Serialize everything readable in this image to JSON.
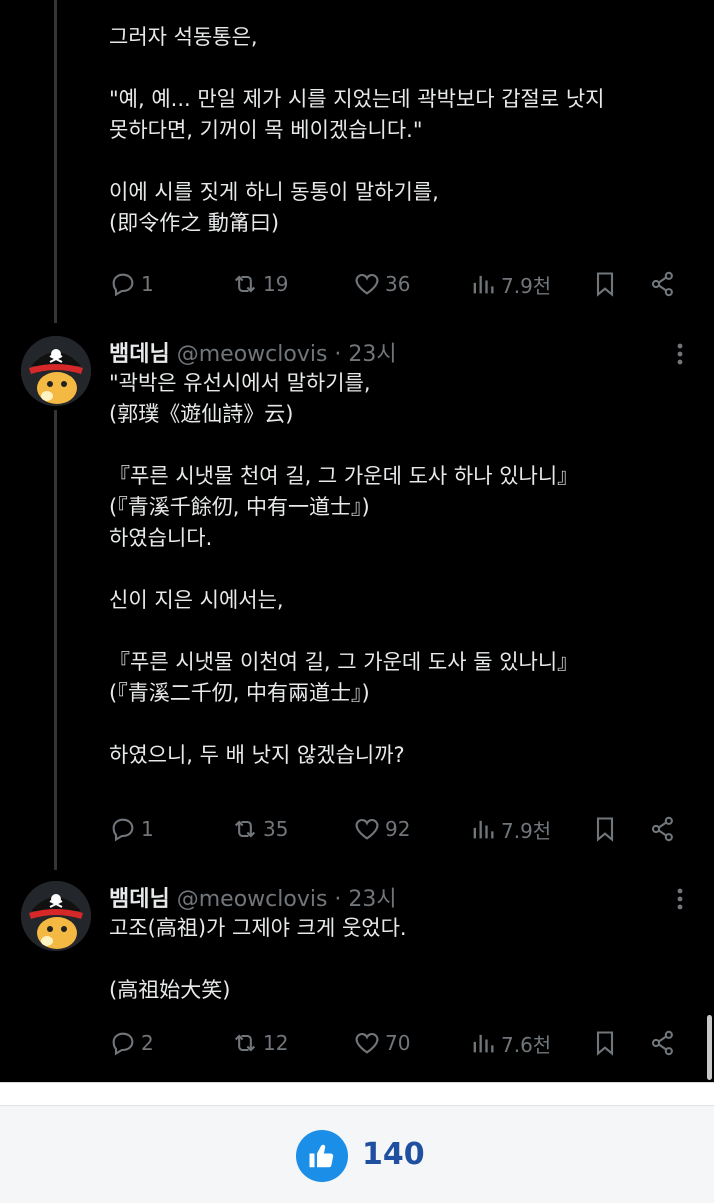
{
  "tweet1": {
    "lines": [
      "그러자 석동통은,",
      "",
      "\"예, 예... 만일 제가 시를 지었는데 곽박보다 갑절로 낫지",
      "못하다면, 기꺼이 목 베이겠습니다.\"",
      "",
      "이에 시를 짓게 하니 동통이 말하기를,",
      "(即令作之 動筩曰)"
    ],
    "replies": "1",
    "retweets": "19",
    "likes": "36",
    "views": "7.9천"
  },
  "tweet2": {
    "name": "뱀데님",
    "handle": "@meowclovis",
    "time": "· 23시",
    "lines": [
      "\"곽박은 유선시에서 말하기를,",
      "(郭璞《遊仙詩》云)",
      "",
      "『푸른 시냇물 천여 길, 그 가운데 도사 하나 있나니』",
      "(『青溪千餘仞, 中有一道士』)",
      "하였습니다.",
      "",
      "신이 지은 시에서는,",
      "",
      "『푸른 시냇물 이천여 길, 그 가운데 도사 둘 있나니』",
      "(『青溪二千仞, 中有兩道士』)",
      "",
      "하였으니, 두 배 낫지 않겠습니까?"
    ],
    "replies": "1",
    "retweets": "35",
    "likes": "92",
    "views": "7.9천"
  },
  "tweet3": {
    "name": "뱀데님",
    "handle": "@meowclovis",
    "time": "· 23시",
    "lines": [
      "고조(高祖)가 그제야 크게 웃었다.",
      "",
      "(高祖始大笑)"
    ],
    "replies": "2",
    "retweets": "12",
    "likes": "70",
    "views": "7.6천"
  },
  "footer": {
    "like_count": "140"
  },
  "colors": {
    "background": "#000000",
    "muted": "#71767b",
    "text": "#e7e9ea",
    "like_blue": "#1b8ee8"
  }
}
